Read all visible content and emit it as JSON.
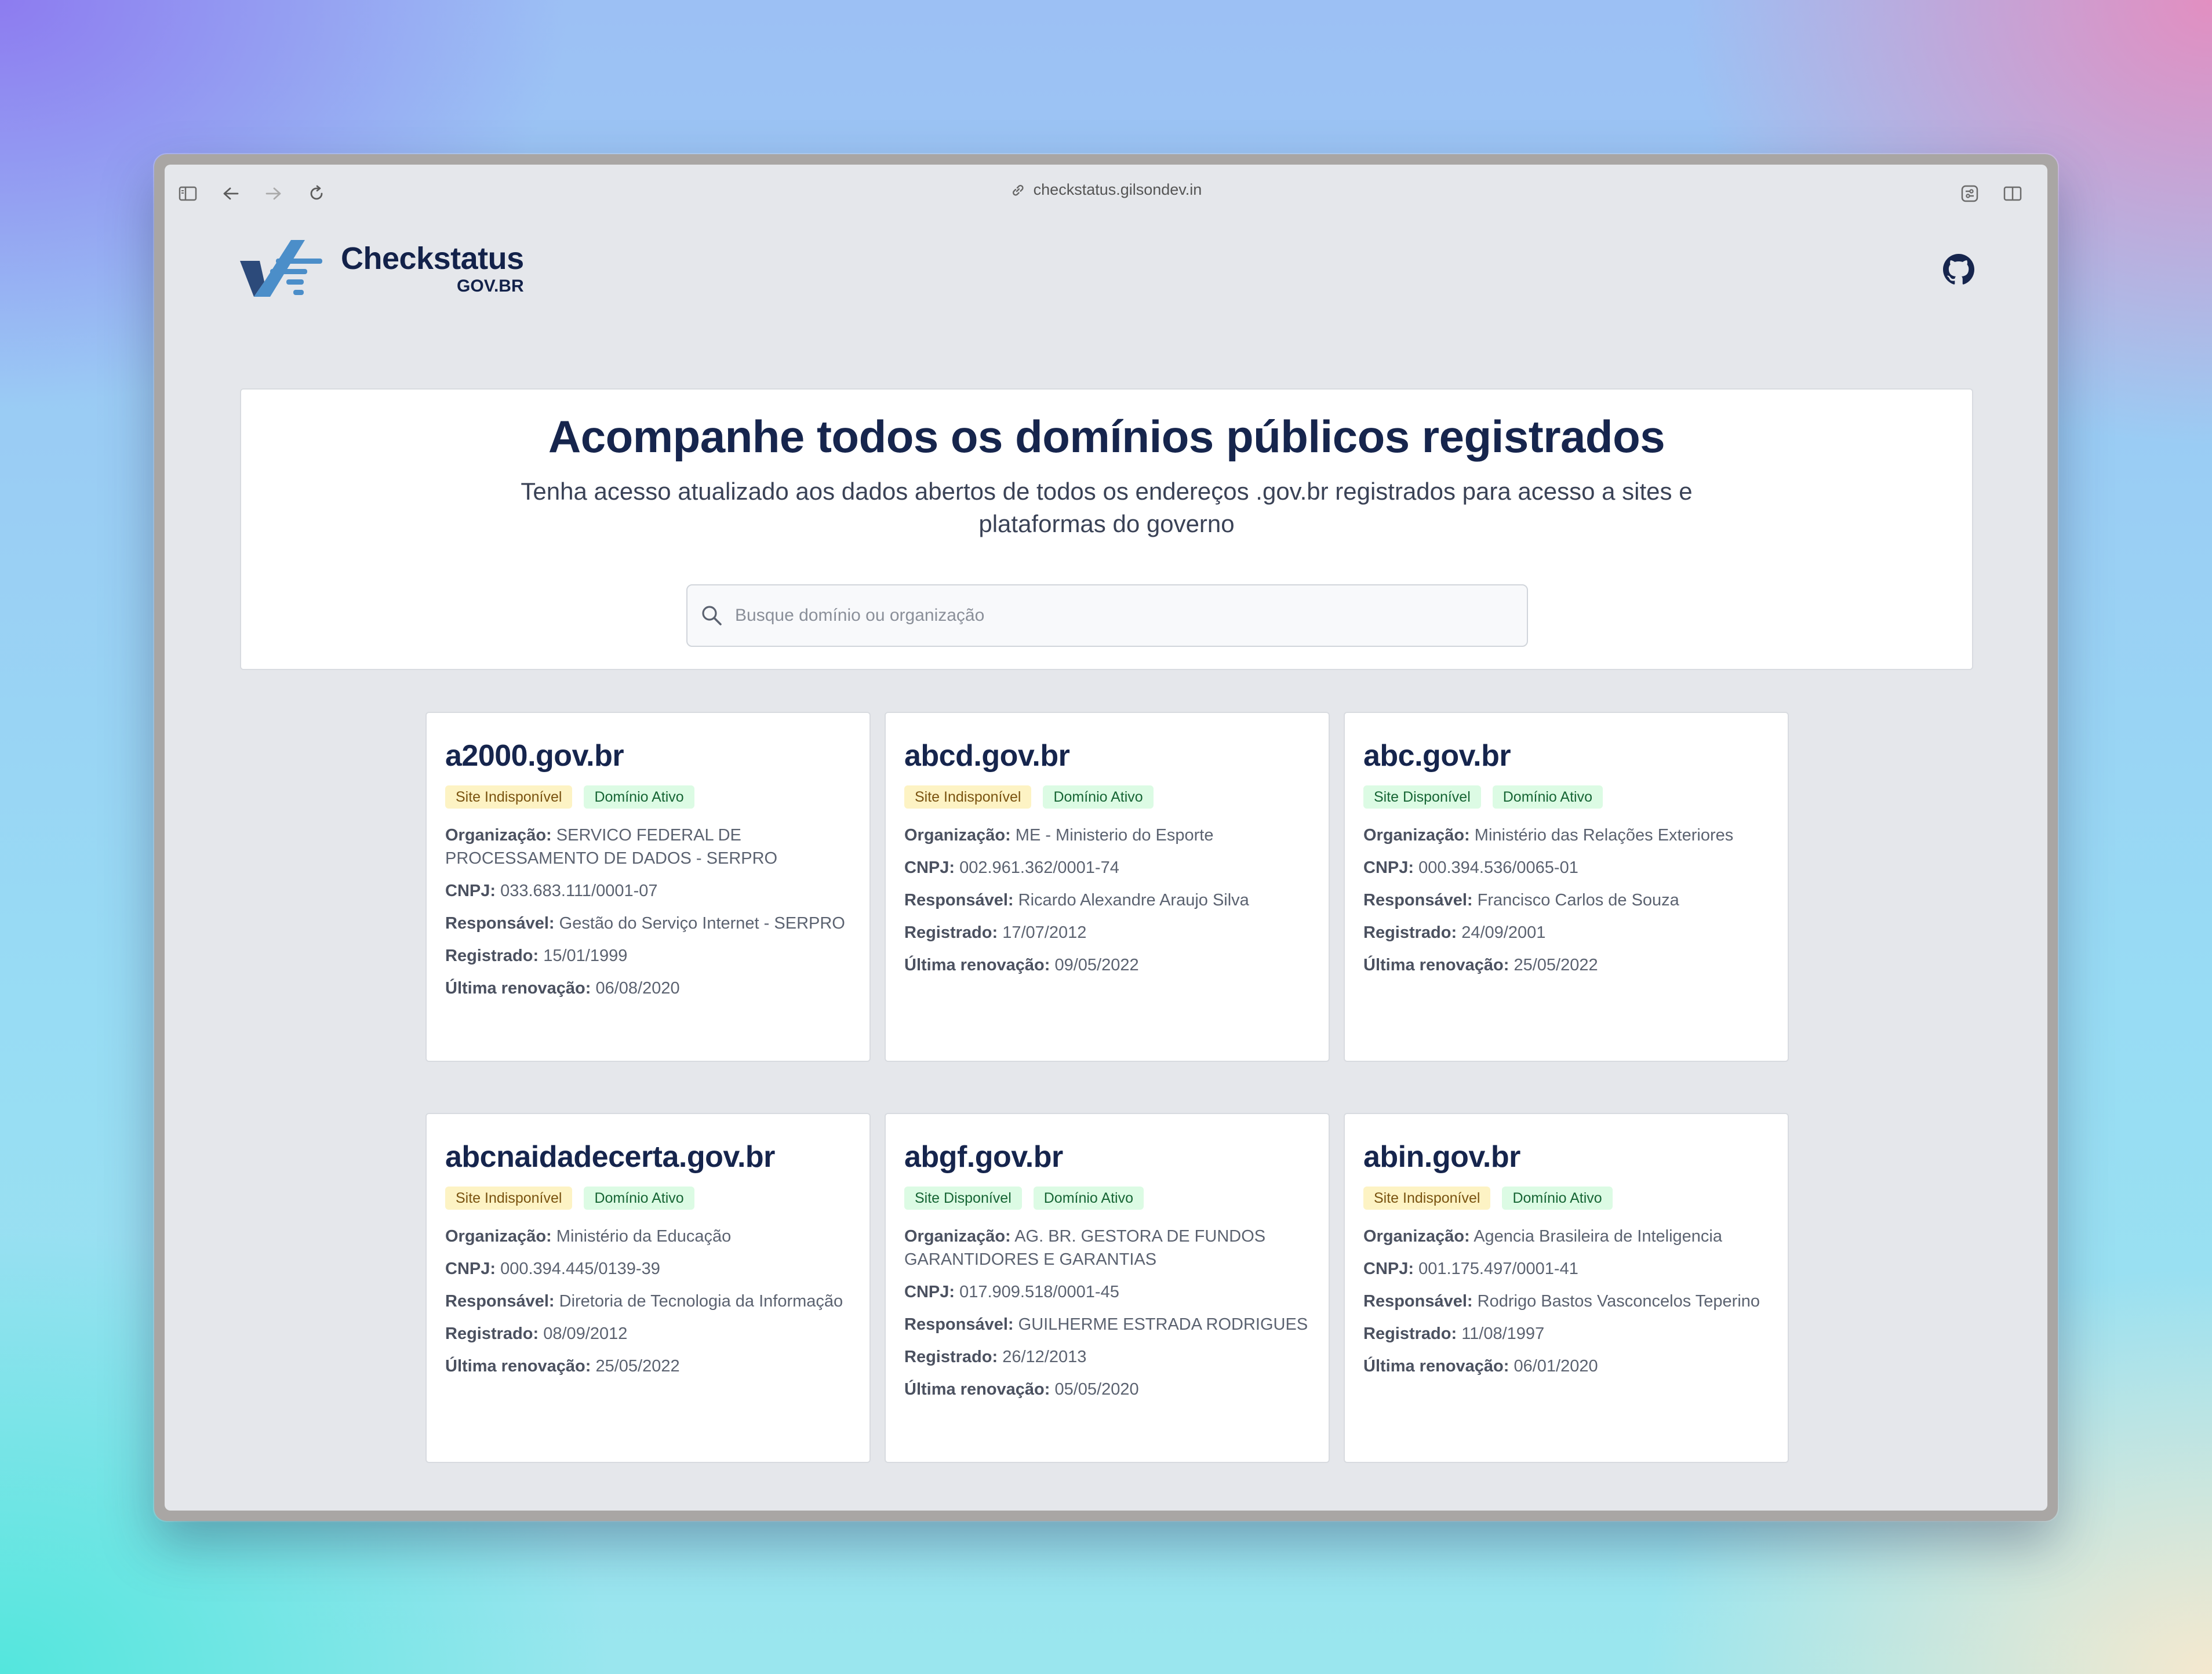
{
  "browser": {
    "url": "checkstatus.gilsondev.in"
  },
  "header": {
    "logo_name": "Checkstatus",
    "logo_sub": "GOV.BR"
  },
  "hero": {
    "title": "Acompanhe todos os domínios públicos registrados",
    "subtitle": "Tenha acesso atualizado aos dados abertos de todos os endereços .gov.br registrados para acesso a sites e plataformas do governo",
    "search_placeholder": "Busque domínio ou organização"
  },
  "labels": {
    "org": "Organização:",
    "cnpj": "CNPJ:",
    "resp": "Responsável:",
    "reg": "Registrado:",
    "renew": "Última renovação:"
  },
  "colors": {
    "brand": "#16254d",
    "badge_warn_bg": "#fdf3c4",
    "badge_ok_bg": "#dcfbe4"
  },
  "cards": [
    {
      "domain": "a2000.gov.br",
      "site_status": "Site Indisponível",
      "domain_status": "Domínio Ativo",
      "org": "SERVICO FEDERAL DE PROCESSAMENTO DE DADOS - SERPRO",
      "cnpj": "033.683.111/0001-07",
      "resp": "Gestão do Serviço Internet - SERPRO",
      "reg": "15/01/1999",
      "renew": "06/08/2020"
    },
    {
      "domain": "abcd.gov.br",
      "site_status": "Site Indisponível",
      "domain_status": "Domínio Ativo",
      "org": "ME - Ministerio do Esporte",
      "cnpj": "002.961.362/0001-74",
      "resp": "Ricardo Alexandre Araujo Silva",
      "reg": "17/07/2012",
      "renew": "09/05/2022"
    },
    {
      "domain": "abc.gov.br",
      "site_status": "Site Disponível",
      "domain_status": "Domínio Ativo",
      "org": "Ministério das Relações Exteriores",
      "cnpj": "000.394.536/0065-01",
      "resp": "Francisco Carlos de Souza",
      "reg": "24/09/2001",
      "renew": "25/05/2022"
    },
    {
      "domain": "abcnaidadecerta.gov.br",
      "site_status": "Site Indisponível",
      "domain_status": "Domínio Ativo",
      "org": "Ministério da Educação",
      "cnpj": "000.394.445/0139-39",
      "resp": "Diretoria de Tecnologia da Informação",
      "reg": "08/09/2012",
      "renew": "25/05/2022"
    },
    {
      "domain": "abgf.gov.br",
      "site_status": "Site Disponível",
      "domain_status": "Domínio Ativo",
      "org": "AG. BR. GESTORA DE FUNDOS GARANTIDORES E GARANTIAS",
      "cnpj": "017.909.518/0001-45",
      "resp": "GUILHERME ESTRADA RODRIGUES",
      "reg": "26/12/2013",
      "renew": "05/05/2020"
    },
    {
      "domain": "abin.gov.br",
      "site_status": "Site Indisponível",
      "domain_status": "Domínio Ativo",
      "org": "Agencia Brasileira de Inteligencia",
      "cnpj": "001.175.497/0001-41",
      "resp": "Rodrigo Bastos Vasconcelos Teperino",
      "reg": "11/08/1997",
      "renew": "06/01/2020"
    }
  ]
}
